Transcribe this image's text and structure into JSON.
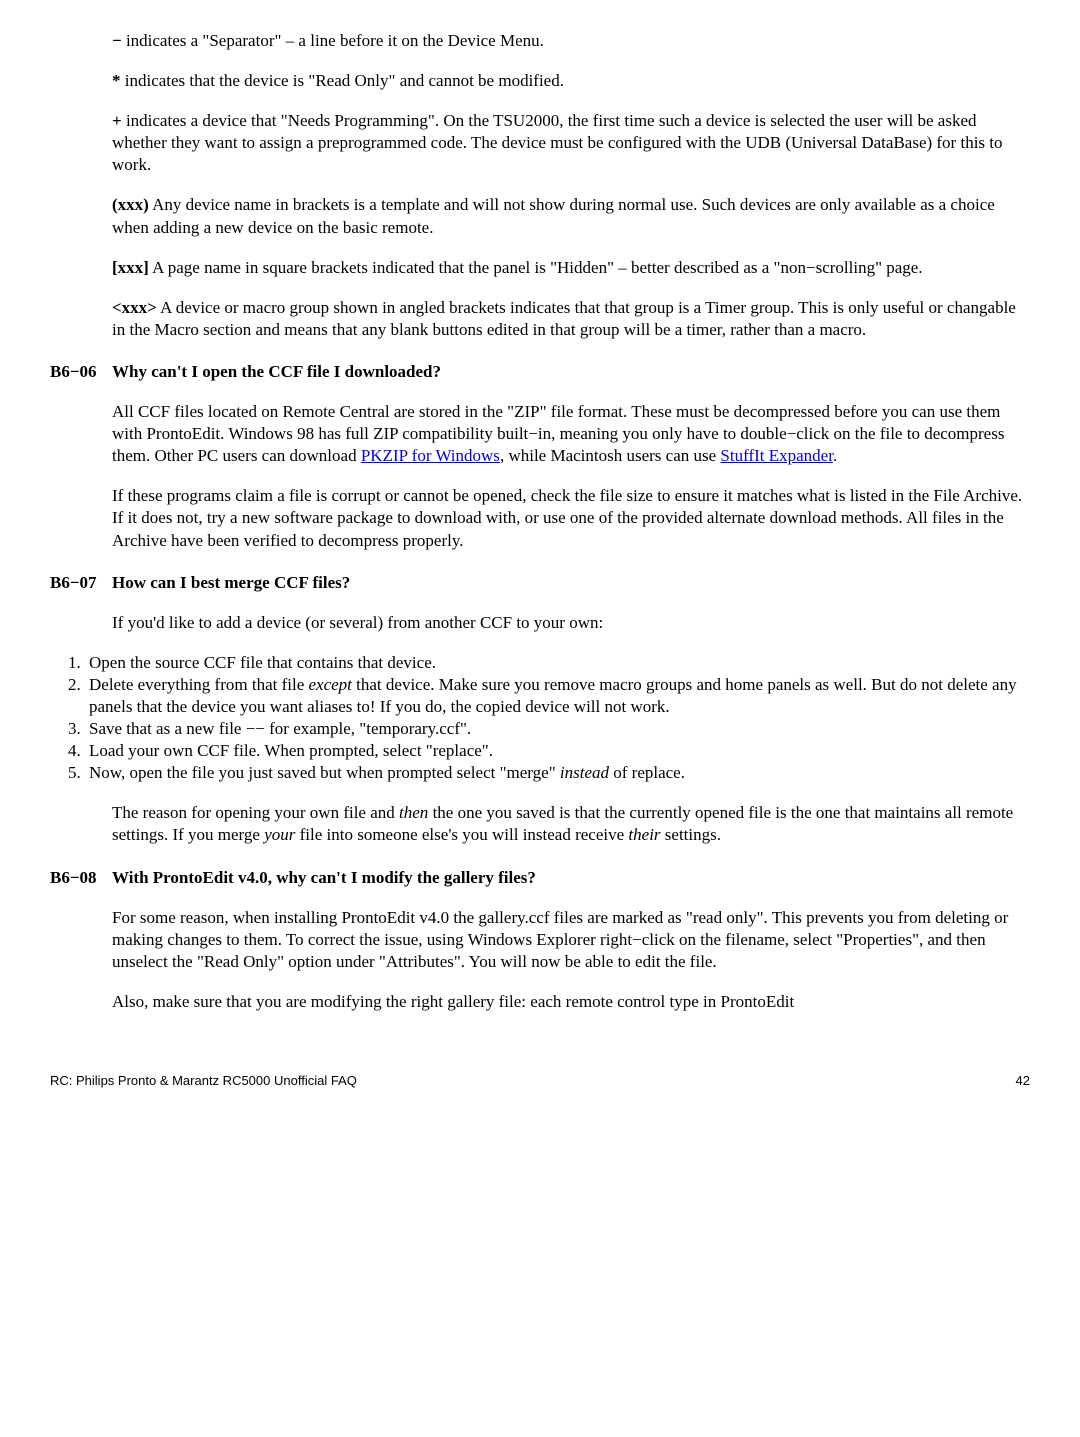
{
  "s1": {
    "p1a": "−",
    "p1b": " indicates a \"Separator\" – a line before it on the Device Menu.",
    "p2a": "*",
    "p2b": " indicates that the device is \"Read Only\" and cannot be modified.",
    "p3a": "+",
    "p3b": " indicates a device that \"Needs Programming\". On the TSU2000, the first time such a device is selected the user will be asked whether they want to assign a preprogrammed code. The device must be configured with the UDB (Universal DataBase) for this to work.",
    "p4a": "(xxx)",
    "p4b": " Any device name in brackets is a template and will not show during normal use. Such devices are only available as a choice when adding a new device on the basic remote.",
    "p5a": "[xxx]",
    "p5b": " A page name in square brackets indicated that the panel is \"Hidden\" – better described as a \"non−scrolling\" page.",
    "p6a": "<xxx>",
    "p6b": " A device or macro group shown in angled brackets indicates that that group is a Timer group. This is only useful or changable in the Macro section and means that any blank buttons edited in that group will be a timer, rather than a macro."
  },
  "h06": {
    "num": "B6−06",
    "text": "Why can't I open the CCF file I downloaded?"
  },
  "s06": {
    "p1a": "All CCF files located on Remote Central are stored in the \"ZIP\" file format. These must be decompressed before you can use them with ProntoEdit. Windows 98 has full ZIP compatibility built−in, meaning you only have to double−click on the file to decompress them. Other PC users can download ",
    "link1": "PKZIP for Windows",
    "p1b": ", while Macintosh users can use ",
    "link2": "StuffIt Expander",
    "p1c": ".",
    "p2": "If these programs claim a file is corrupt or cannot be opened, check the file size to ensure it matches what is listed in the File Archive. If it does not, try a new software package to download with, or use one of the provided alternate download methods. All files in the Archive have been verified to decompress properly."
  },
  "h07": {
    "num": "B6−07",
    "text": "How can I best merge CCF files?"
  },
  "s07": {
    "intro": "If you'd like to add a device (or several) from another CCF to your own:",
    "li1": "Open the source CCF file that contains that device.",
    "li2a": "Delete everything from that file ",
    "li2i": "except",
    "li2b": " that device. Make sure you remove macro groups and home panels as well. But do not delete any panels that the device you want aliases to! If you do, the copied device will not work.",
    "li3": "Save that as a new file −− for example, \"temporary.ccf\".",
    "li4": "Load your own CCF file. When prompted, select \"replace\".",
    "li5a": "Now, open the file you just saved but when prompted select \"merge\" ",
    "li5i": "instead",
    "li5b": " of replace.",
    "p2a": "The reason for opening your own file and ",
    "p2i1": "then",
    "p2b": " the one you saved is that the currently opened file is the one that maintains all remote settings. If you merge ",
    "p2i2": "your",
    "p2c": " file into someone else's you will instead receive ",
    "p2i3": "their",
    "p2d": " settings."
  },
  "h08": {
    "num": "B6−08",
    "text": "With ProntoEdit v4.0, why can't I modify the gallery files?"
  },
  "s08": {
    "p1": "For some reason, when installing ProntoEdit v4.0 the gallery.ccf files are marked as \"read only\". This prevents you from deleting or making changes to them. To correct the issue, using Windows Explorer right−click on the filename, select \"Properties\", and then unselect the \"Read Only\" option under \"Attributes\". You will now be able to edit the file.",
    "p2": "Also, make sure that you are modifying the right gallery file: each remote control type in ProntoEdit"
  },
  "footer": {
    "left": "RC: Philips Pronto & Marantz RC5000 Unofficial FAQ",
    "right": "42"
  }
}
